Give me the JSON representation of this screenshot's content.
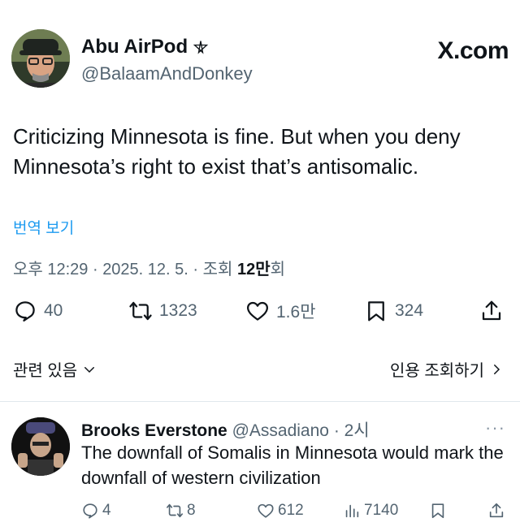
{
  "tweet": {
    "author_name": "Abu AirPod",
    "author_badge_icon": "pentagram-icon",
    "author_handle": "@BalaamAndDonkey",
    "brand": "X.com",
    "text": "Criticizing Minnesota is fine. But when you deny Minnesota’s right to exist that’s antisomalic.",
    "translate_label": "번역 보기",
    "meta": {
      "time": "오후 12:29",
      "date": "2025. 12. 5.",
      "views_label": "조회",
      "views_count": "12만",
      "views_suffix": "회"
    },
    "actions": {
      "replies": "40",
      "retweets": "1323",
      "likes": "1.6만",
      "bookmarks": "324"
    },
    "related_label": "관련 있음",
    "quotes_label": "인용 조회하기"
  },
  "reply": {
    "author_name": "Brooks Everstone",
    "author_handle": "@Assadiano",
    "time": "2시",
    "text": "The downfall of Somalis in Minnesota would mark the downfall of western civilization",
    "actions": {
      "replies": "4",
      "retweets": "8",
      "likes": "612",
      "views": "7140"
    }
  },
  "colors": {
    "text": "#0f1419",
    "secondary": "#536471",
    "link": "#1d9bf0",
    "divider": "#e1e8ed"
  }
}
